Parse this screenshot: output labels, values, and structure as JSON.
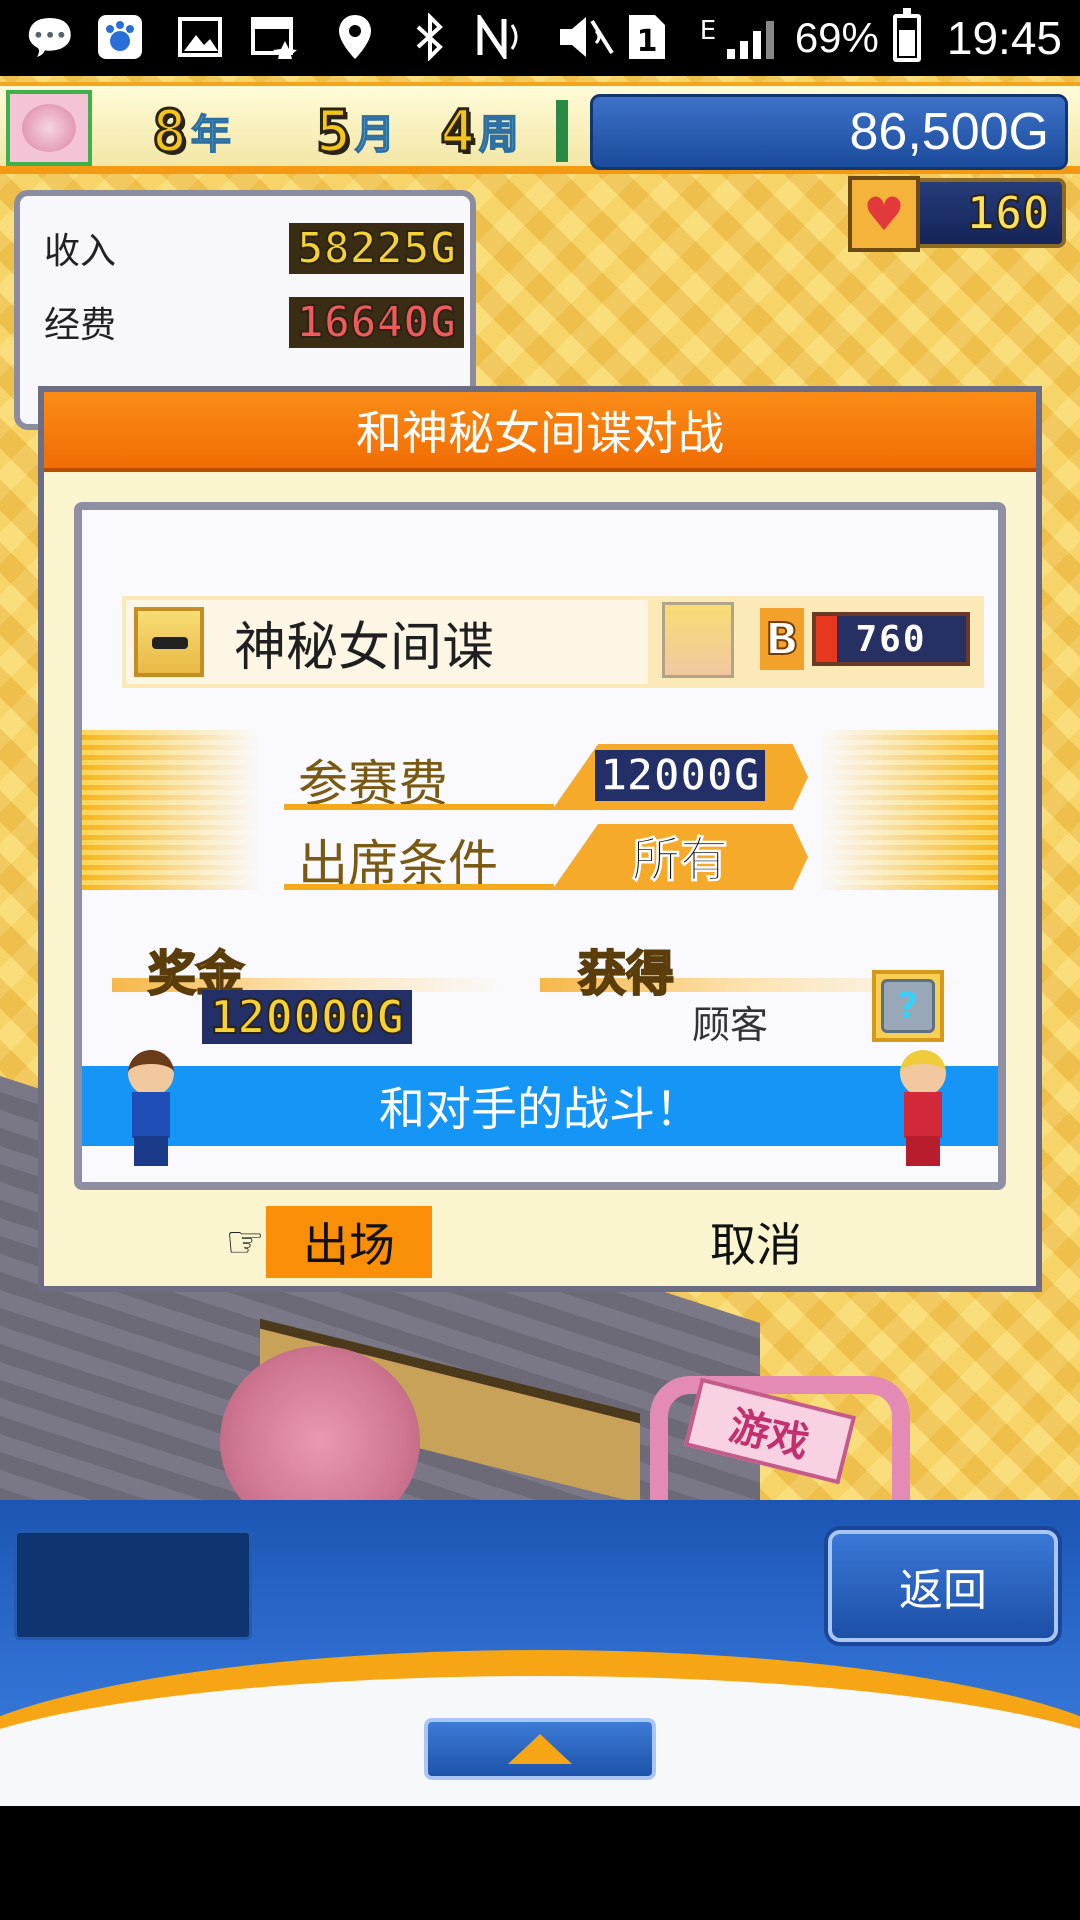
{
  "status_bar": {
    "icons": [
      "chat-icon",
      "baidu-icon",
      "image-icon",
      "calendar-icon",
      "location-icon",
      "bluetooth-icon",
      "nfc-icon",
      "mute-icon",
      "sim-1-icon",
      "signal-icon"
    ],
    "network_label": "E",
    "battery": "69%",
    "time": "19:45"
  },
  "hud": {
    "year_num": "8",
    "year_unit": "年",
    "month_num": "5",
    "month_unit": "月",
    "week_num": "4",
    "week_unit": "周",
    "money": "86,500G",
    "popularity": "160"
  },
  "finance": {
    "income_label": "收入",
    "income_value": "58225G",
    "expense_label": "经费",
    "expense_value": "16640G"
  },
  "dialog": {
    "title": "和神秘女间谍对战",
    "opponent_name": "神秘女间谍",
    "rank": "B",
    "power": "760",
    "fee_label": "参赛费",
    "fee_value": "12000G",
    "condition_label": "出席条件",
    "condition_value": "所有",
    "prize_label": "奖金",
    "prize_value": "120000G",
    "gain_label": "获得",
    "gain_value": "顾客",
    "gain_icon": "?",
    "battle_text": "和对手的战斗！",
    "confirm_label": "出场",
    "cancel_label": "取消"
  },
  "scene": {
    "arch_sign": "游戏"
  },
  "bottom": {
    "back_label": "返回"
  },
  "colors": {
    "title_orange": "#f06d05",
    "battle_blue": "#1596f6",
    "money_blue": "#1b4b9b",
    "confirm_orange": "#f98e07"
  }
}
